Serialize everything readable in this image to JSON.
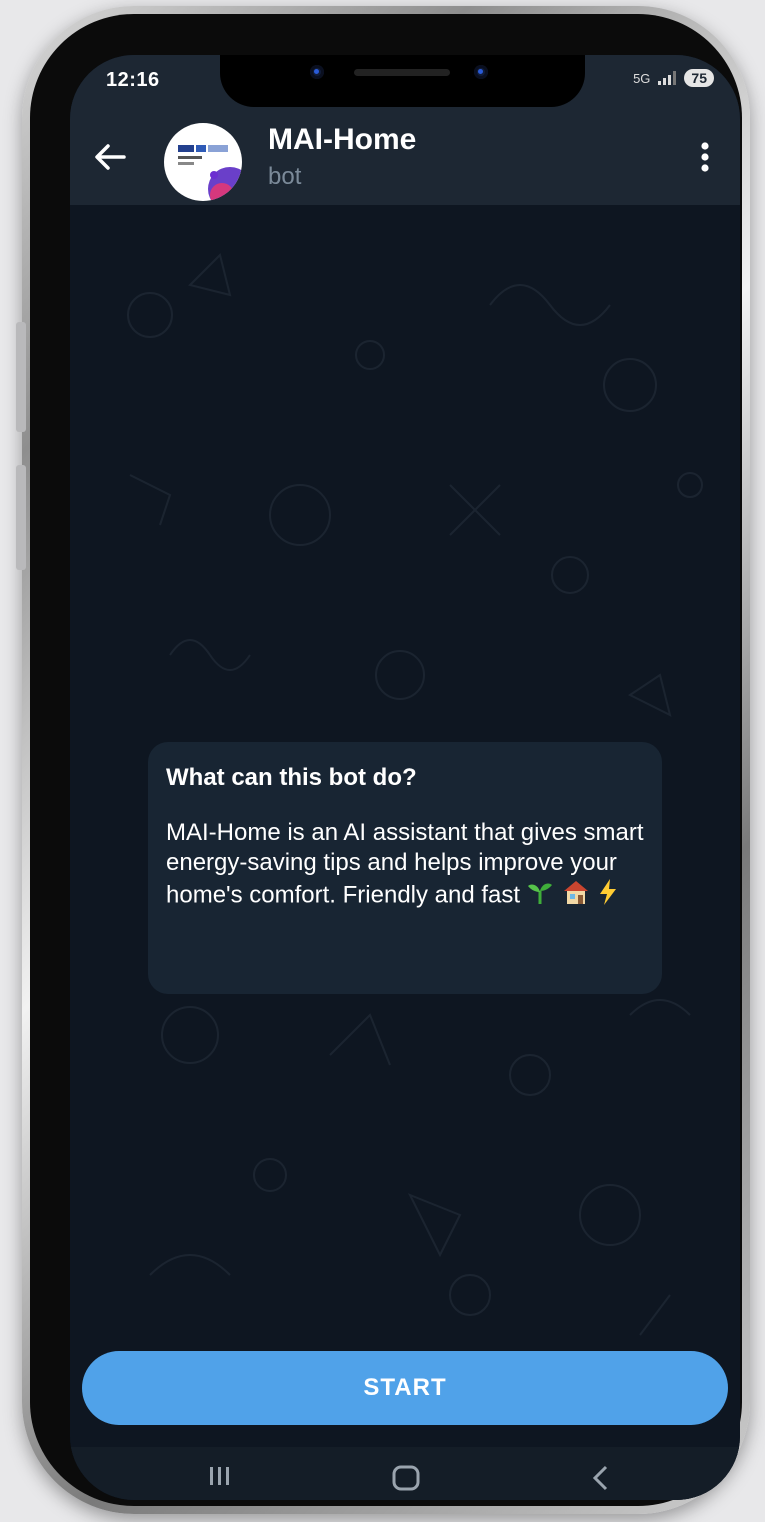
{
  "status_bar": {
    "time": "12:16",
    "network": "5G",
    "battery": "75"
  },
  "header": {
    "title": "MAI-Home",
    "subtitle": "bot"
  },
  "bot_intro": {
    "heading": "What can this bot do?",
    "text": "MAI-Home is an AI assistant that gives smart energy-saving tips and helps improve your home's comfort. Friendly and fast",
    "emojis": [
      "seedling-icon",
      "house-icon",
      "lightning-icon"
    ]
  },
  "actions": {
    "start_label": "START"
  },
  "colors": {
    "chat_background": "#0e1621",
    "header_background": "#1d2733",
    "bubble_background": "#182533",
    "accent": "#50a2e9"
  }
}
